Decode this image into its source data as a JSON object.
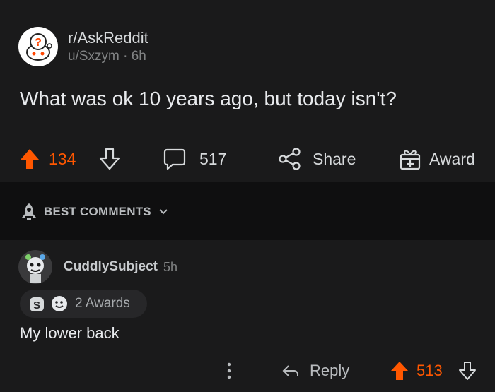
{
  "post": {
    "subreddit": "r/AskReddit",
    "author_line": "u/Sxzym · 6h",
    "title": "What was ok 10 years ago, but today isn't?",
    "upvotes": "134",
    "comments": "517",
    "share_label": "Share",
    "award_label": "Award"
  },
  "sort": {
    "label": "BEST COMMENTS"
  },
  "comment": {
    "author": "CuddlySubject",
    "time": "5h",
    "awards": "2 Awards",
    "body": "My lower back",
    "reply_label": "Reply",
    "score": "513"
  },
  "colors": {
    "background": "#1a1a1b",
    "divider": "#0f0f10",
    "upvote": "#ff5700",
    "text": "#d7dadc",
    "muted": "#818384"
  },
  "icons": [
    "subreddit-avatar-icon",
    "upvote-icon",
    "downvote-icon",
    "comment-icon",
    "share-icon",
    "award-icon",
    "rocket-icon",
    "chevron-down-icon",
    "user-avatar-icon",
    "silver-award-icon",
    "wholesome-award-icon",
    "more-icon",
    "reply-icon"
  ]
}
